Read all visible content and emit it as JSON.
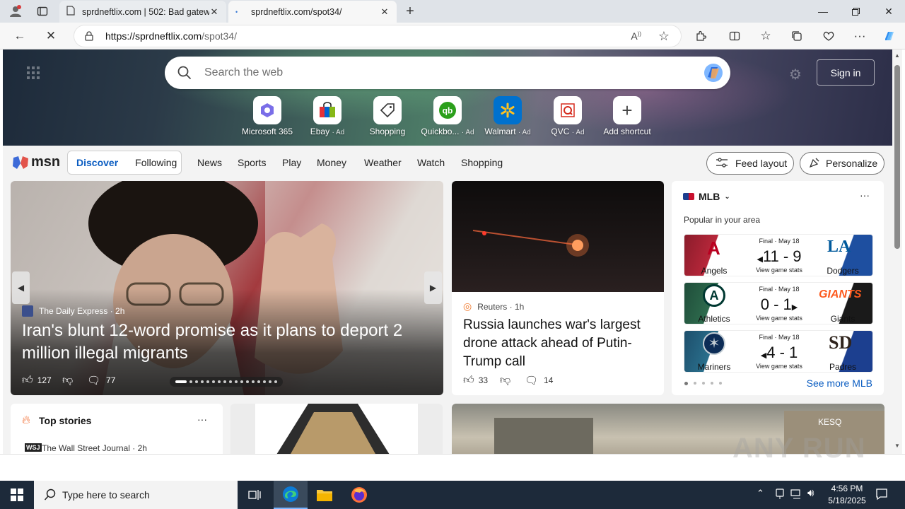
{
  "browser": {
    "tabs": [
      {
        "title": "sprdneftlix.com | 502: Bad gatew",
        "active": false
      },
      {
        "title": "sprdneftlix.com/spot34/",
        "active": true
      }
    ],
    "url_host": "https://sprdneftlix.com",
    "url_path": "/spot34/"
  },
  "search": {
    "placeholder": "Search the web"
  },
  "header": {
    "sign_in": "Sign in"
  },
  "shortcuts": [
    {
      "label": "Microsoft 365",
      "ad": "",
      "icon": "microsoft365-icon",
      "color": "#7a6ee8"
    },
    {
      "label": "Ebay",
      "ad": "· Ad",
      "icon": "ebay-icon",
      "color": "#e53238"
    },
    {
      "label": "Shopping",
      "ad": "",
      "icon": "shopping-tag-icon",
      "color": "#333333"
    },
    {
      "label": "Quickbo...",
      "ad": "· Ad",
      "icon": "quickbooks-icon",
      "color": "#2ca01c"
    },
    {
      "label": "Walmart",
      "ad": "· Ad",
      "icon": "walmart-icon",
      "color": "#0071ce"
    },
    {
      "label": "QVC",
      "ad": "· Ad",
      "icon": "qvc-icon",
      "color": "#d52b1e"
    },
    {
      "label": "Add shortcut",
      "ad": "",
      "icon": "plus-icon",
      "color": "#444444"
    }
  ],
  "msn": {
    "logo": "msn",
    "segments": [
      "Discover",
      "Following"
    ],
    "nav": [
      "News",
      "Sports",
      "Play",
      "Money",
      "Weather",
      "Watch",
      "Shopping"
    ],
    "feed_layout": "Feed layout",
    "personalize": "Personalize"
  },
  "main_story": {
    "source": "The Daily Express",
    "age": "· 2h",
    "headline": "Iran's blunt 12-word promise as it plans to deport 2 million illegal migrants",
    "likes": "127",
    "comments": "77"
  },
  "second_story": {
    "source": "Reuters",
    "age": "· 1h",
    "headline": "Russia launches war's largest drone attack ahead of Putin-Trump call",
    "likes": "33",
    "comments": "14"
  },
  "mlb": {
    "title": "MLB",
    "subtitle": "Popular in your area",
    "games": [
      {
        "status": "Final · May 18",
        "left": "Angels",
        "right": "Dodgers",
        "score": "11 - 9",
        "winner": "left",
        "stats": "View game stats",
        "leftColor": "#8a1c2b",
        "rightColor": "#1e4fa0"
      },
      {
        "status": "Final · May 18",
        "left": "Athletics",
        "right": "Giants",
        "score": "0 - 1",
        "winner": "right",
        "stats": "View game stats",
        "leftColor": "#1f4d3a",
        "rightColor": "#1a1a1a"
      },
      {
        "status": "Final · May 18",
        "left": "Mariners",
        "right": "Padres",
        "score": "4 - 1",
        "winner": "left",
        "stats": "View game stats",
        "leftColor": "#1d4e6b",
        "rightColor": "#2b2b2b"
      }
    ],
    "see_more": "See more MLB"
  },
  "top_stories": {
    "title": "Top stories",
    "source": "The Wall Street Journal · 2h"
  },
  "watermark": "ANY RUN",
  "taskbar": {
    "search_placeholder": "Type here to search",
    "time": "4:56 PM",
    "date": "5/18/2025"
  }
}
